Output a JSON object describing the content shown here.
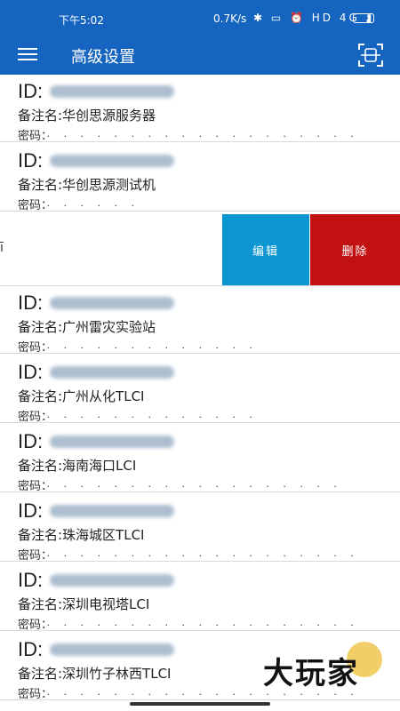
{
  "status": {
    "time": "下午5:02",
    "speed": "0.7K/s",
    "icons": "✱ ▭ ⏰ HD 4G ▮",
    "battery": "74"
  },
  "appbar": {
    "title": "高级设置"
  },
  "cards_top": [
    {
      "id_label": "ID:",
      "remark": "备注名:华创思源服务器",
      "pwd_label": "密码：",
      "pwd_dots": "· · · · · · · · · · · · · · · · · · ·"
    },
    {
      "id_label": "ID:",
      "remark": "备注名:华创思源测试机",
      "pwd_label": "密码：",
      "pwd_dots": "· · · · · ·"
    }
  ],
  "swipe": {
    "rest_text": "ī",
    "edit": "编辑",
    "delete": "删除"
  },
  "cards_bottom": [
    {
      "id_label": "ID:",
      "remark": "备注名:广州雷灾实验站",
      "pwd_label": "密码：",
      "pwd_dots": "· · · · · · · · · · · · ·"
    },
    {
      "id_label": "ID:",
      "remark": "备注名:广州从化TLCI",
      "pwd_label": "密码：",
      "pwd_dots": "· · · · · · · · · · · · ·"
    },
    {
      "id_label": "ID:",
      "remark": "备注名:海南海口LCI",
      "pwd_label": "密码：",
      "pwd_dots": "· · · · · · · · · · · · · · · · · ·"
    },
    {
      "id_label": "ID:",
      "remark": "备注名:珠海城区TLCI",
      "pwd_label": "密码：",
      "pwd_dots": "· · · · · · · · · · · · · · · · · · ·"
    },
    {
      "id_label": "ID:",
      "remark": "备注名:深圳电视塔LCI",
      "pwd_label": "密码：",
      "pwd_dots": "· · · · · · · · · · · · · · · · · · ·"
    },
    {
      "id_label": "ID:",
      "remark": "备注名:深圳竹子林西TLCI",
      "pwd_label": "密码：",
      "pwd_dots": "· · · · · · · · · · · · · · · · · · ·"
    }
  ],
  "watermark": {
    "text": "大玩家"
  }
}
